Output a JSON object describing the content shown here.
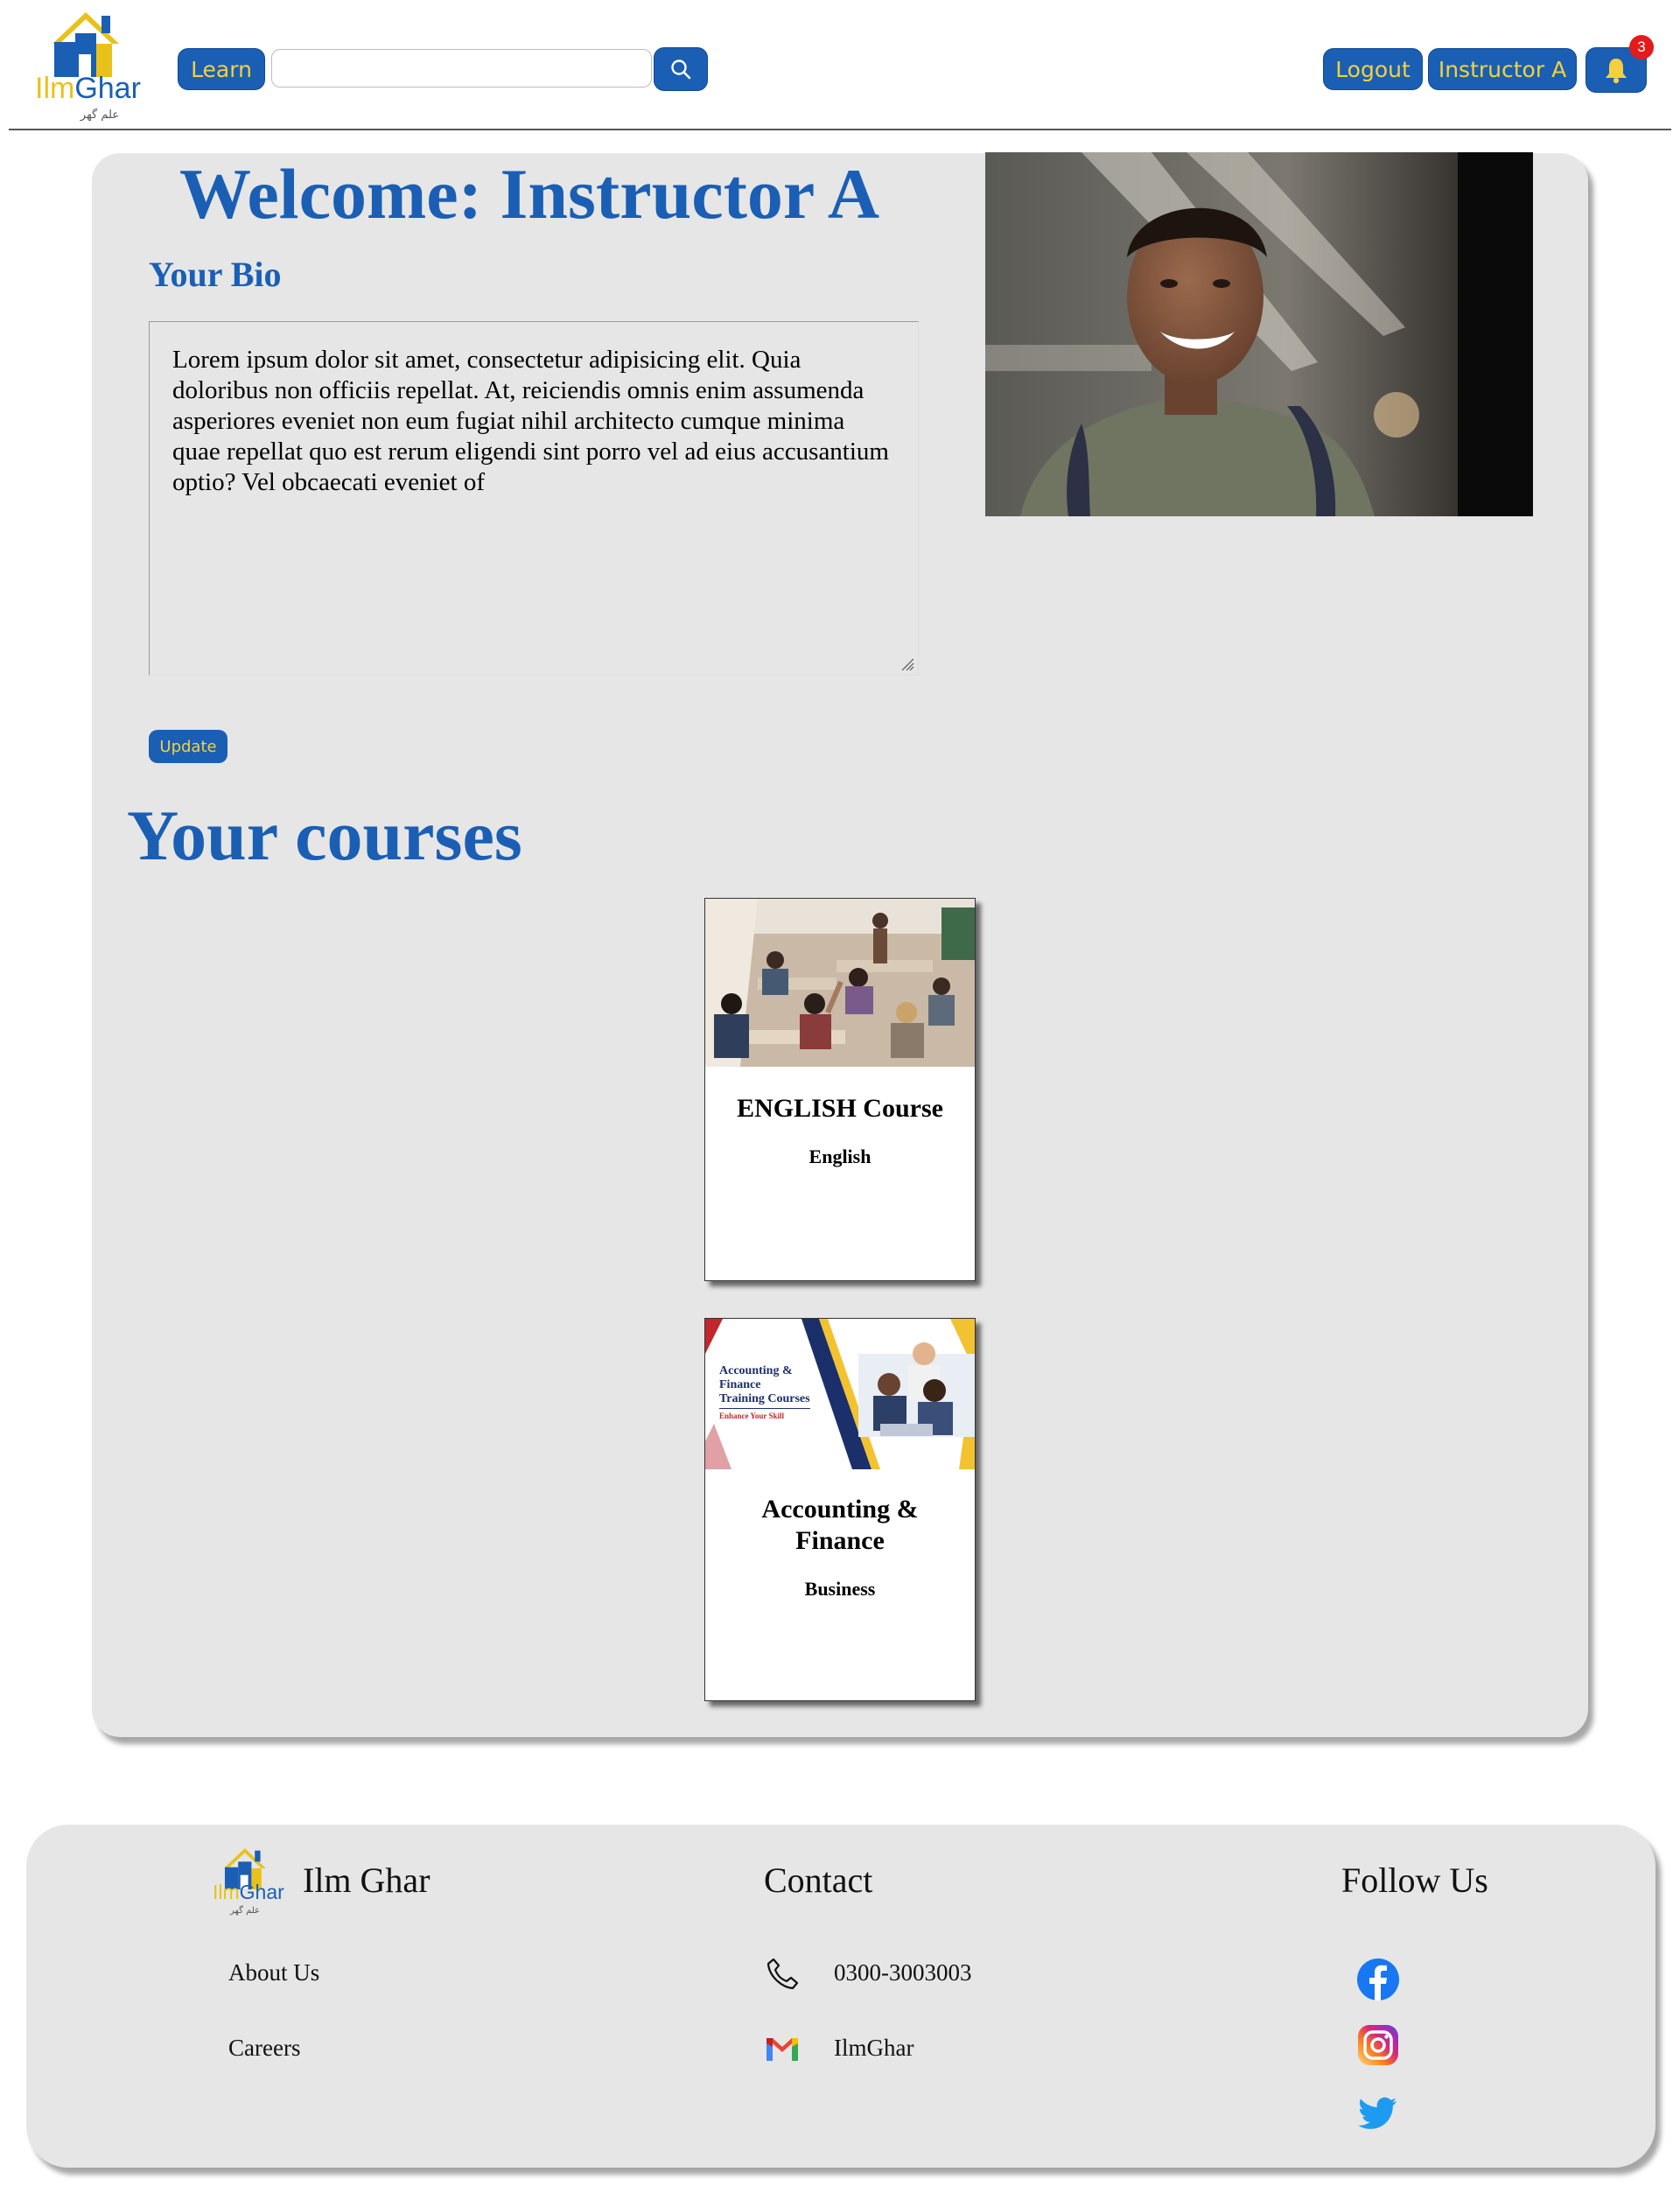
{
  "header": {
    "logo": {
      "text_ilm": "Ilm",
      "text_ghar": "Ghar",
      "urdu": "علم گھر"
    },
    "learn_label": "Learn",
    "search": {
      "value": "",
      "placeholder": ""
    },
    "logout_label": "Logout",
    "user_label": "Instructor A",
    "notification_count": "3",
    "icons": {
      "search": "search-icon",
      "notifications": "bell-icon"
    }
  },
  "main": {
    "welcome": "Welcome: Instructor A",
    "bio_heading": "Your Bio",
    "bio_text": "Lorem ipsum dolor sit amet, consectetur adipisicing elit. Quia doloribus non officiis repellat. At, reiciendis omnis enim assumenda asperiores eveniet non eum fugiat nihil architecto cumque minima quae repellat quo est rerum eligendi sint porro vel ad eius accusantium optio? Vel obcaecati eveniet of",
    "update_label": "Update",
    "courses_heading": "Your courses",
    "courses": [
      {
        "title": "ENGLISH Course",
        "category": "English"
      },
      {
        "title": "Accounting & Finance",
        "category": "Business",
        "banner": {
          "line1": "Accounting &",
          "line2": "Finance",
          "line3": "Training Courses",
          "tagline": "Enhance Your Skill"
        }
      }
    ]
  },
  "footer": {
    "brand": "Ilm Ghar",
    "logo": {
      "text_ilm": "Ilm",
      "text_ghar": "Ghar",
      "urdu": "علم گھر"
    },
    "contact_heading": "Contact",
    "follow_heading": "Follow Us",
    "links": [
      "About Us",
      "Careers"
    ],
    "phone": "0300-3003003",
    "email": "IlmGhar",
    "social_icons": [
      "facebook-icon",
      "instagram-icon",
      "twitter-icon"
    ]
  },
  "colors": {
    "brand_blue": "#1a5fb4",
    "brand_yellow": "#f4d03f",
    "panel_gray": "#e6e6e7",
    "badge_red": "#e41b1b"
  }
}
